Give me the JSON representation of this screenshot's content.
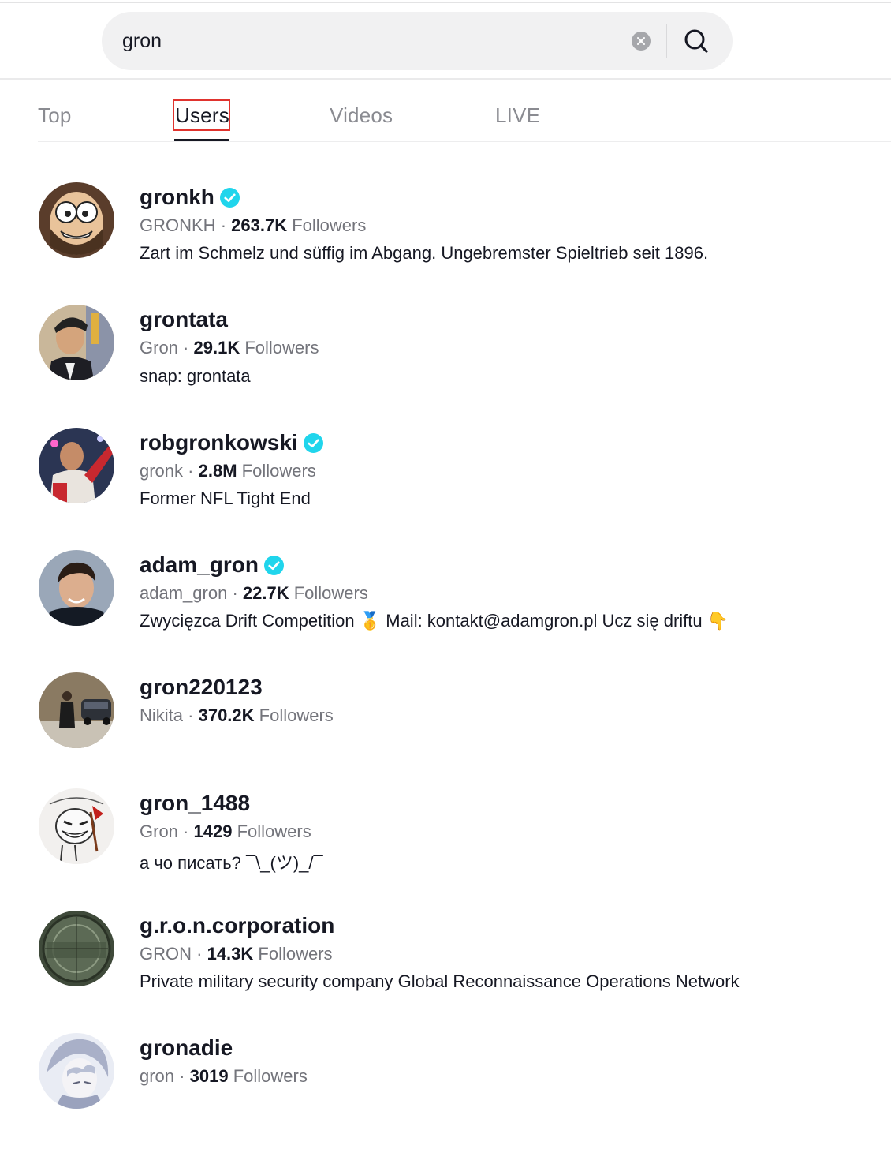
{
  "search": {
    "query": "gron"
  },
  "tabs": [
    {
      "label": "Top"
    },
    {
      "label": "Users"
    },
    {
      "label": "Videos"
    },
    {
      "label": "LIVE"
    }
  ],
  "active_tab": "Users",
  "users": [
    {
      "username": "gronkh",
      "verified": true,
      "nickname": "GRONKH",
      "followers": "263.7K",
      "followers_label": "Followers",
      "bio": "Zart im Schmelz und süffig im Abgang. Ungebremster Spieltrieb seit 1896."
    },
    {
      "username": "grontata",
      "verified": false,
      "nickname": "Gron",
      "followers": "29.1K",
      "followers_label": "Followers",
      "bio": "snap: grontata"
    },
    {
      "username": "robgronkowski",
      "verified": true,
      "nickname": "gronk",
      "followers": "2.8M",
      "followers_label": "Followers",
      "bio": "Former NFL Tight End"
    },
    {
      "username": "adam_gron",
      "verified": true,
      "nickname": "adam_gron",
      "followers": "22.7K",
      "followers_label": "Followers",
      "bio": "Zwycięzca Drift Competition 🥇 Mail: kontakt@adamgron.pl Ucz się driftu 👇"
    },
    {
      "username": "gron220123",
      "verified": false,
      "nickname": "Nikita",
      "followers": "370.2K",
      "followers_label": "Followers",
      "bio": ""
    },
    {
      "username": "gron_1488",
      "verified": false,
      "nickname": "Gron",
      "followers": "1429",
      "followers_label": "Followers",
      "bio": "а чо писать? ¯\\_(ツ)_/¯"
    },
    {
      "username": "g.r.o.n.corporation",
      "verified": false,
      "nickname": "GRON",
      "followers": "14.3K",
      "followers_label": "Followers",
      "bio": "Private military security company Global Reconnaissance Operations Network"
    },
    {
      "username": "gronadie",
      "verified": false,
      "nickname": "gron",
      "followers": "3019",
      "followers_label": "Followers",
      "bio": ""
    }
  ],
  "separator": "·",
  "colors": {
    "verified": "#20d5ec",
    "highlight": "#e0332e",
    "text_primary": "#161823",
    "text_secondary": "#73747b"
  }
}
